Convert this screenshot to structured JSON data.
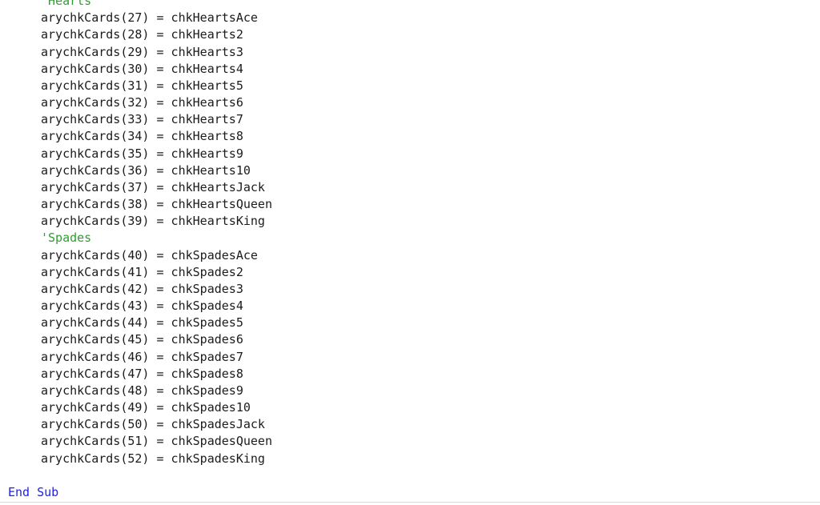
{
  "editor": {
    "language": "VBA",
    "background_color": "#ffffff",
    "text_color": "#1b1b1b",
    "comment_color": "#2f9e2f",
    "keyword_color": "#2222e0",
    "divider_color": "#d9d9d9",
    "lines": [
      {
        "text": "'Hearts",
        "kind": "comment",
        "indent": 1
      },
      {
        "text": "arychkCards(27) = chkHeartsAce",
        "kind": "code",
        "indent": 1
      },
      {
        "text": "arychkCards(28) = chkHearts2",
        "kind": "code",
        "indent": 1
      },
      {
        "text": "arychkCards(29) = chkHearts3",
        "kind": "code",
        "indent": 1
      },
      {
        "text": "arychkCards(30) = chkHearts4",
        "kind": "code",
        "indent": 1
      },
      {
        "text": "arychkCards(31) = chkHearts5",
        "kind": "code",
        "indent": 1
      },
      {
        "text": "arychkCards(32) = chkHearts6",
        "kind": "code",
        "indent": 1
      },
      {
        "text": "arychkCards(33) = chkHearts7",
        "kind": "code",
        "indent": 1
      },
      {
        "text": "arychkCards(34) = chkHearts8",
        "kind": "code",
        "indent": 1
      },
      {
        "text": "arychkCards(35) = chkHearts9",
        "kind": "code",
        "indent": 1
      },
      {
        "text": "arychkCards(36) = chkHearts10",
        "kind": "code",
        "indent": 1
      },
      {
        "text": "arychkCards(37) = chkHeartsJack",
        "kind": "code",
        "indent": 1
      },
      {
        "text": "arychkCards(38) = chkHeartsQueen",
        "kind": "code",
        "indent": 1
      },
      {
        "text": "arychkCards(39) = chkHeartsKing",
        "kind": "code",
        "indent": 1
      },
      {
        "text": "'Spades",
        "kind": "comment",
        "indent": 1
      },
      {
        "text": "arychkCards(40) = chkSpadesAce",
        "kind": "code",
        "indent": 1
      },
      {
        "text": "arychkCards(41) = chkSpades2",
        "kind": "code",
        "indent": 1
      },
      {
        "text": "arychkCards(42) = chkSpades3",
        "kind": "code",
        "indent": 1
      },
      {
        "text": "arychkCards(43) = chkSpades4",
        "kind": "code",
        "indent": 1
      },
      {
        "text": "arychkCards(44) = chkSpades5",
        "kind": "code",
        "indent": 1
      },
      {
        "text": "arychkCards(45) = chkSpades6",
        "kind": "code",
        "indent": 1
      },
      {
        "text": "arychkCards(46) = chkSpades7",
        "kind": "code",
        "indent": 1
      },
      {
        "text": "arychkCards(47) = chkSpades8",
        "kind": "code",
        "indent": 1
      },
      {
        "text": "arychkCards(48) = chkSpades9",
        "kind": "code",
        "indent": 1
      },
      {
        "text": "arychkCards(49) = chkSpades10",
        "kind": "code",
        "indent": 1
      },
      {
        "text": "arychkCards(50) = chkSpadesJack",
        "kind": "code",
        "indent": 1
      },
      {
        "text": "arychkCards(51) = chkSpadesQueen",
        "kind": "code",
        "indent": 1
      },
      {
        "text": "arychkCards(52) = chkSpadesKing",
        "kind": "code",
        "indent": 1
      },
      {
        "text": "",
        "kind": "blank",
        "indent": 0
      },
      {
        "text": "End Sub",
        "kind": "keyword",
        "indent": 0
      }
    ]
  }
}
